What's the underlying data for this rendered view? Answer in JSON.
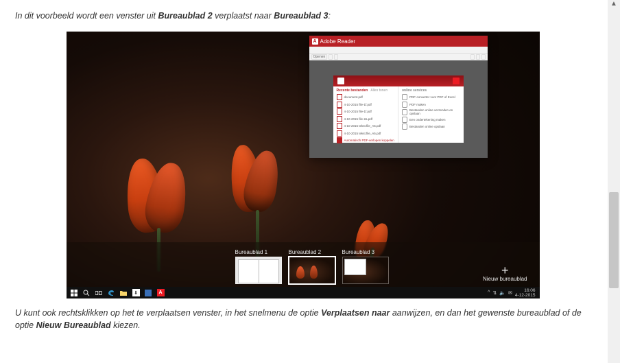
{
  "intro": {
    "pre": "In dit voorbeeld wordt een venster uit ",
    "b1": "Bureaublad 2",
    "mid": " verplaatst naar ",
    "b2": "Bureaublad 3",
    "post": ":"
  },
  "outro": {
    "t1": "U kunt ook rechtsklikken op het te verplaatsen venster, in het snelmenu de optie ",
    "b1": "Verplaatsen naar",
    "t2": " aanwijzen, en dan het gewenste bureaublad of de optie ",
    "b2": "Nieuw Bureaublad",
    "t3": " kiezen."
  },
  "adobe": {
    "title": "Adobe Reader",
    "toolbar": {
      "a": "Openen",
      "b": "",
      "c": "",
      "d": "",
      "e": ""
    },
    "left_head": "Recente bestanden",
    "left_head_gray": "Alles tonen",
    "right_head": "online services",
    "left_items": [
      "document.pdf",
      "4-10-2015 file-1f.pdf",
      "4-10-2015 file-1f.pdf",
      "4-10-2015 file-2a.pdf",
      "4-10-2015 tekst.file_A5.pdf",
      "4-10-2015 tekst.file_A5.pdf"
    ],
    "right_items": [
      "PDF‑converter voor PDF of Excel",
      "PDF maken",
      "Bestanden online verzenden en opslaan",
      "Een ondertekening maken",
      "Bestanden online opslaan"
    ],
    "red_item": "Automatisch PDF‑verlopen koppelen"
  },
  "desktops": {
    "d1": "Bureaublad 1",
    "d2": "Bureaublad 2",
    "d3": "Bureaublad 3",
    "new_label": "Nieuw bureaublad",
    "plus": "+"
  },
  "taskbar": {
    "time": "16:06",
    "date": "4-12-2015",
    "chev": "^",
    "net": "⇅",
    "vol": "🔈",
    "msg": "✉"
  }
}
